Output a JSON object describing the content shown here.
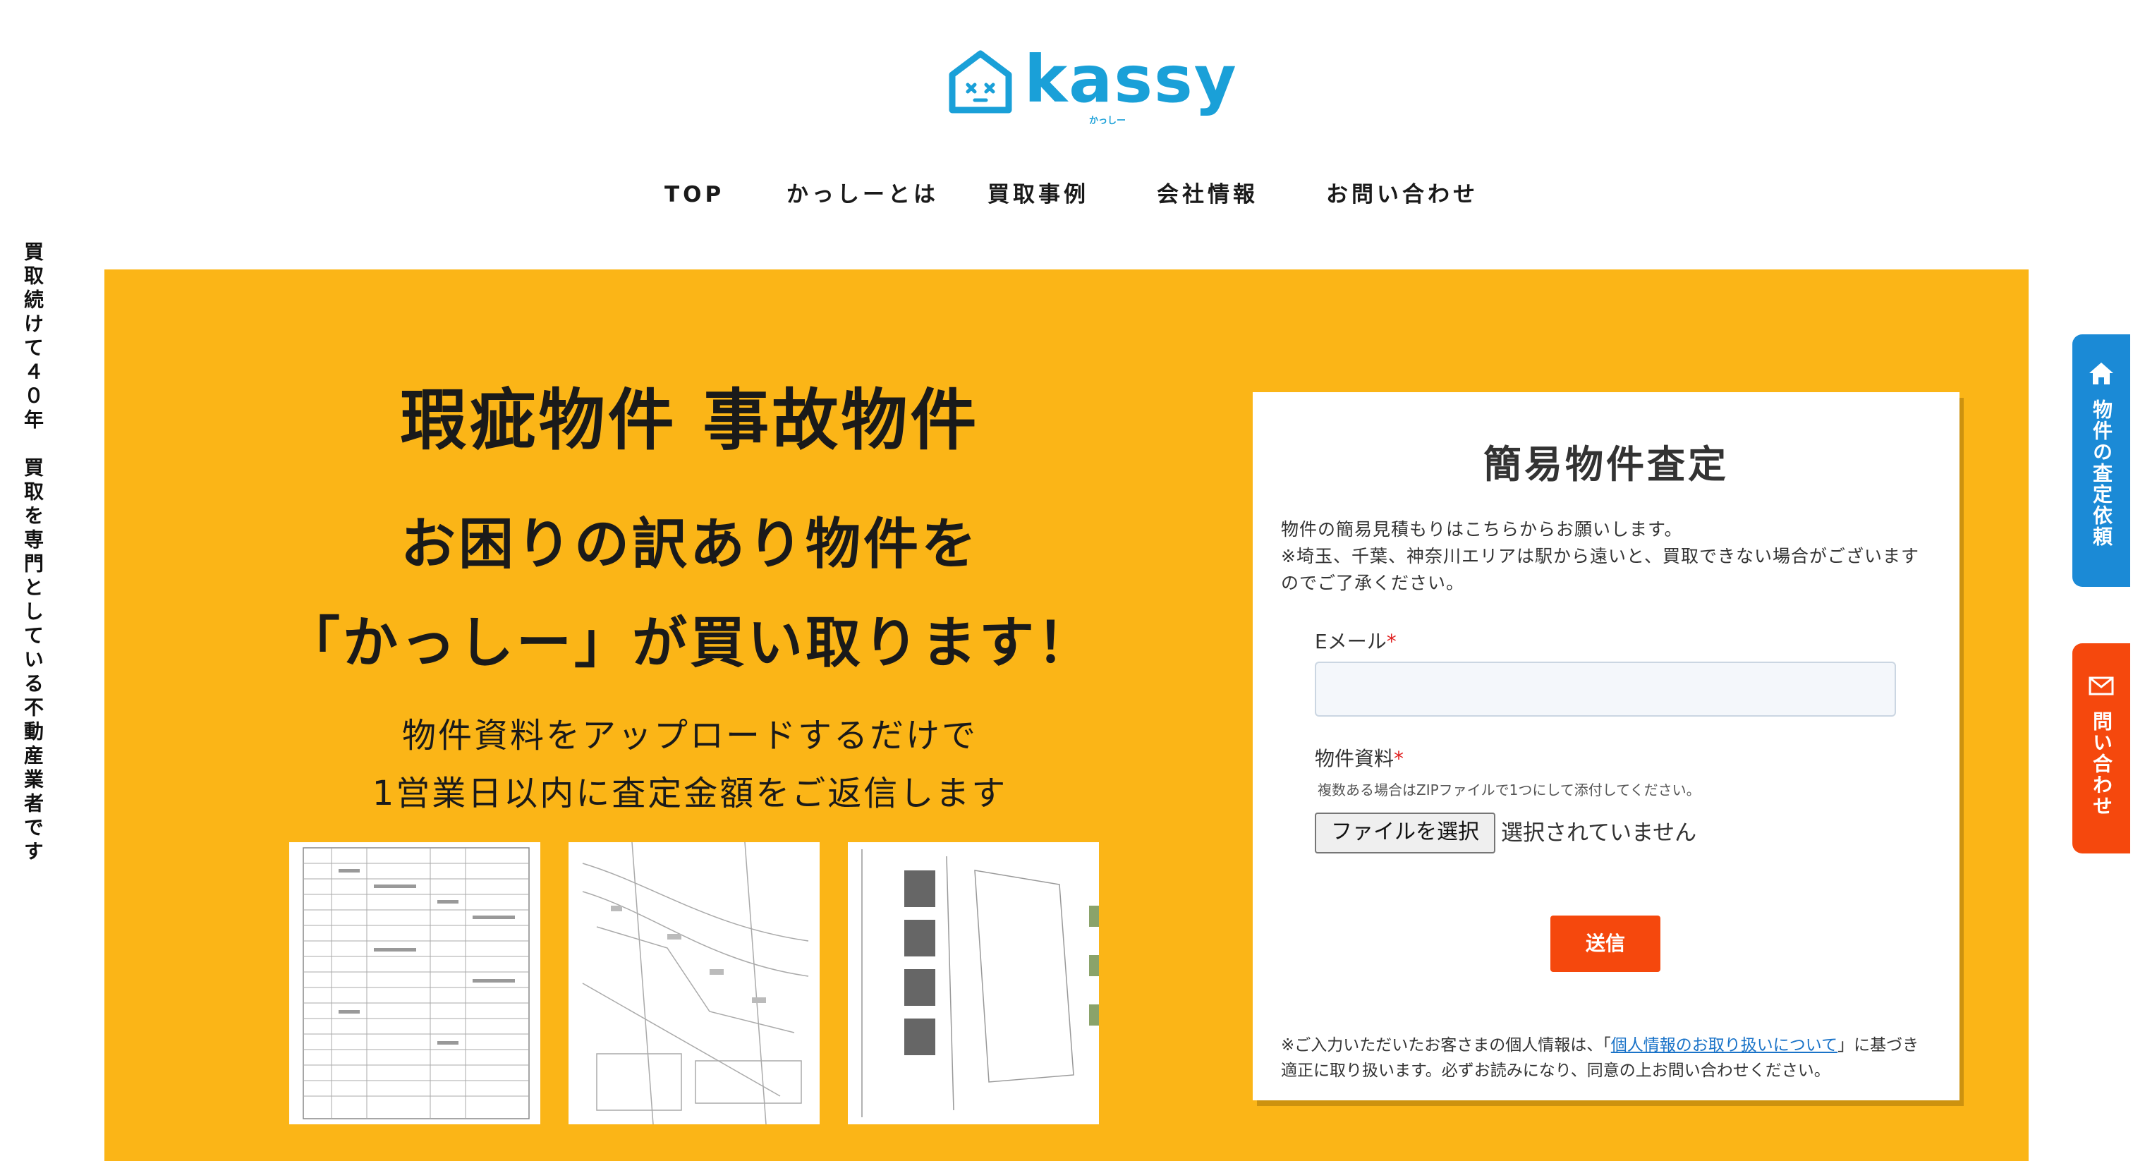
{
  "logo": {
    "brand": "kassy",
    "sub": "かっしー"
  },
  "nav": {
    "items": [
      "TOP",
      "かっしーとは",
      "買取事例",
      "会社情報",
      "お問い合わせ"
    ]
  },
  "vertical_tagline": "買取続けて４０年　買取を専門としている不動産業者です",
  "hero": {
    "title": "瑕疵物件 事故物件",
    "headline_1": "お困りの訳あり物件を",
    "headline_2": "「かっしー」が買い取ります！",
    "sub_1": "物件資料をアップロードするだけで",
    "sub_2": "1営業日以内に査定金額をご返信します"
  },
  "form": {
    "title": "簡易物件査定",
    "intro_1": "物件の簡易見積もりはこちらからお願いします。",
    "intro_2": "※埼玉、千葉、神奈川エリアは駅から遠いと、買取できない場合がございますのでご了承ください。",
    "email_label": "Eメール",
    "files_label": "物件資料",
    "required_mark": "*",
    "files_hint": "複数ある場合はZIPファイルで1つにして添付してください。",
    "file_button": "ファイルを選択",
    "file_status": "選択されていません",
    "submit_label": "送信",
    "privacy_pre": "※ご入力いただいたお客さまの個人情報は、「",
    "privacy_link": "個人情報のお取り扱いについて",
    "privacy_post": "」に基づき適正に取り扱います。必ずお読みになり、同意の上お問い合わせください。"
  },
  "side_tabs": {
    "assess": {
      "label": "物件の査定依頼",
      "icon": "home-icon",
      "color": "#1b8ad6"
    },
    "contact": {
      "label": "問い合わせ",
      "icon": "mail-icon",
      "color": "#f5480d"
    }
  },
  "colors": {
    "hero_bg": "#fbb517",
    "brand": "#1aa0d8",
    "submit": "#f5480d"
  }
}
